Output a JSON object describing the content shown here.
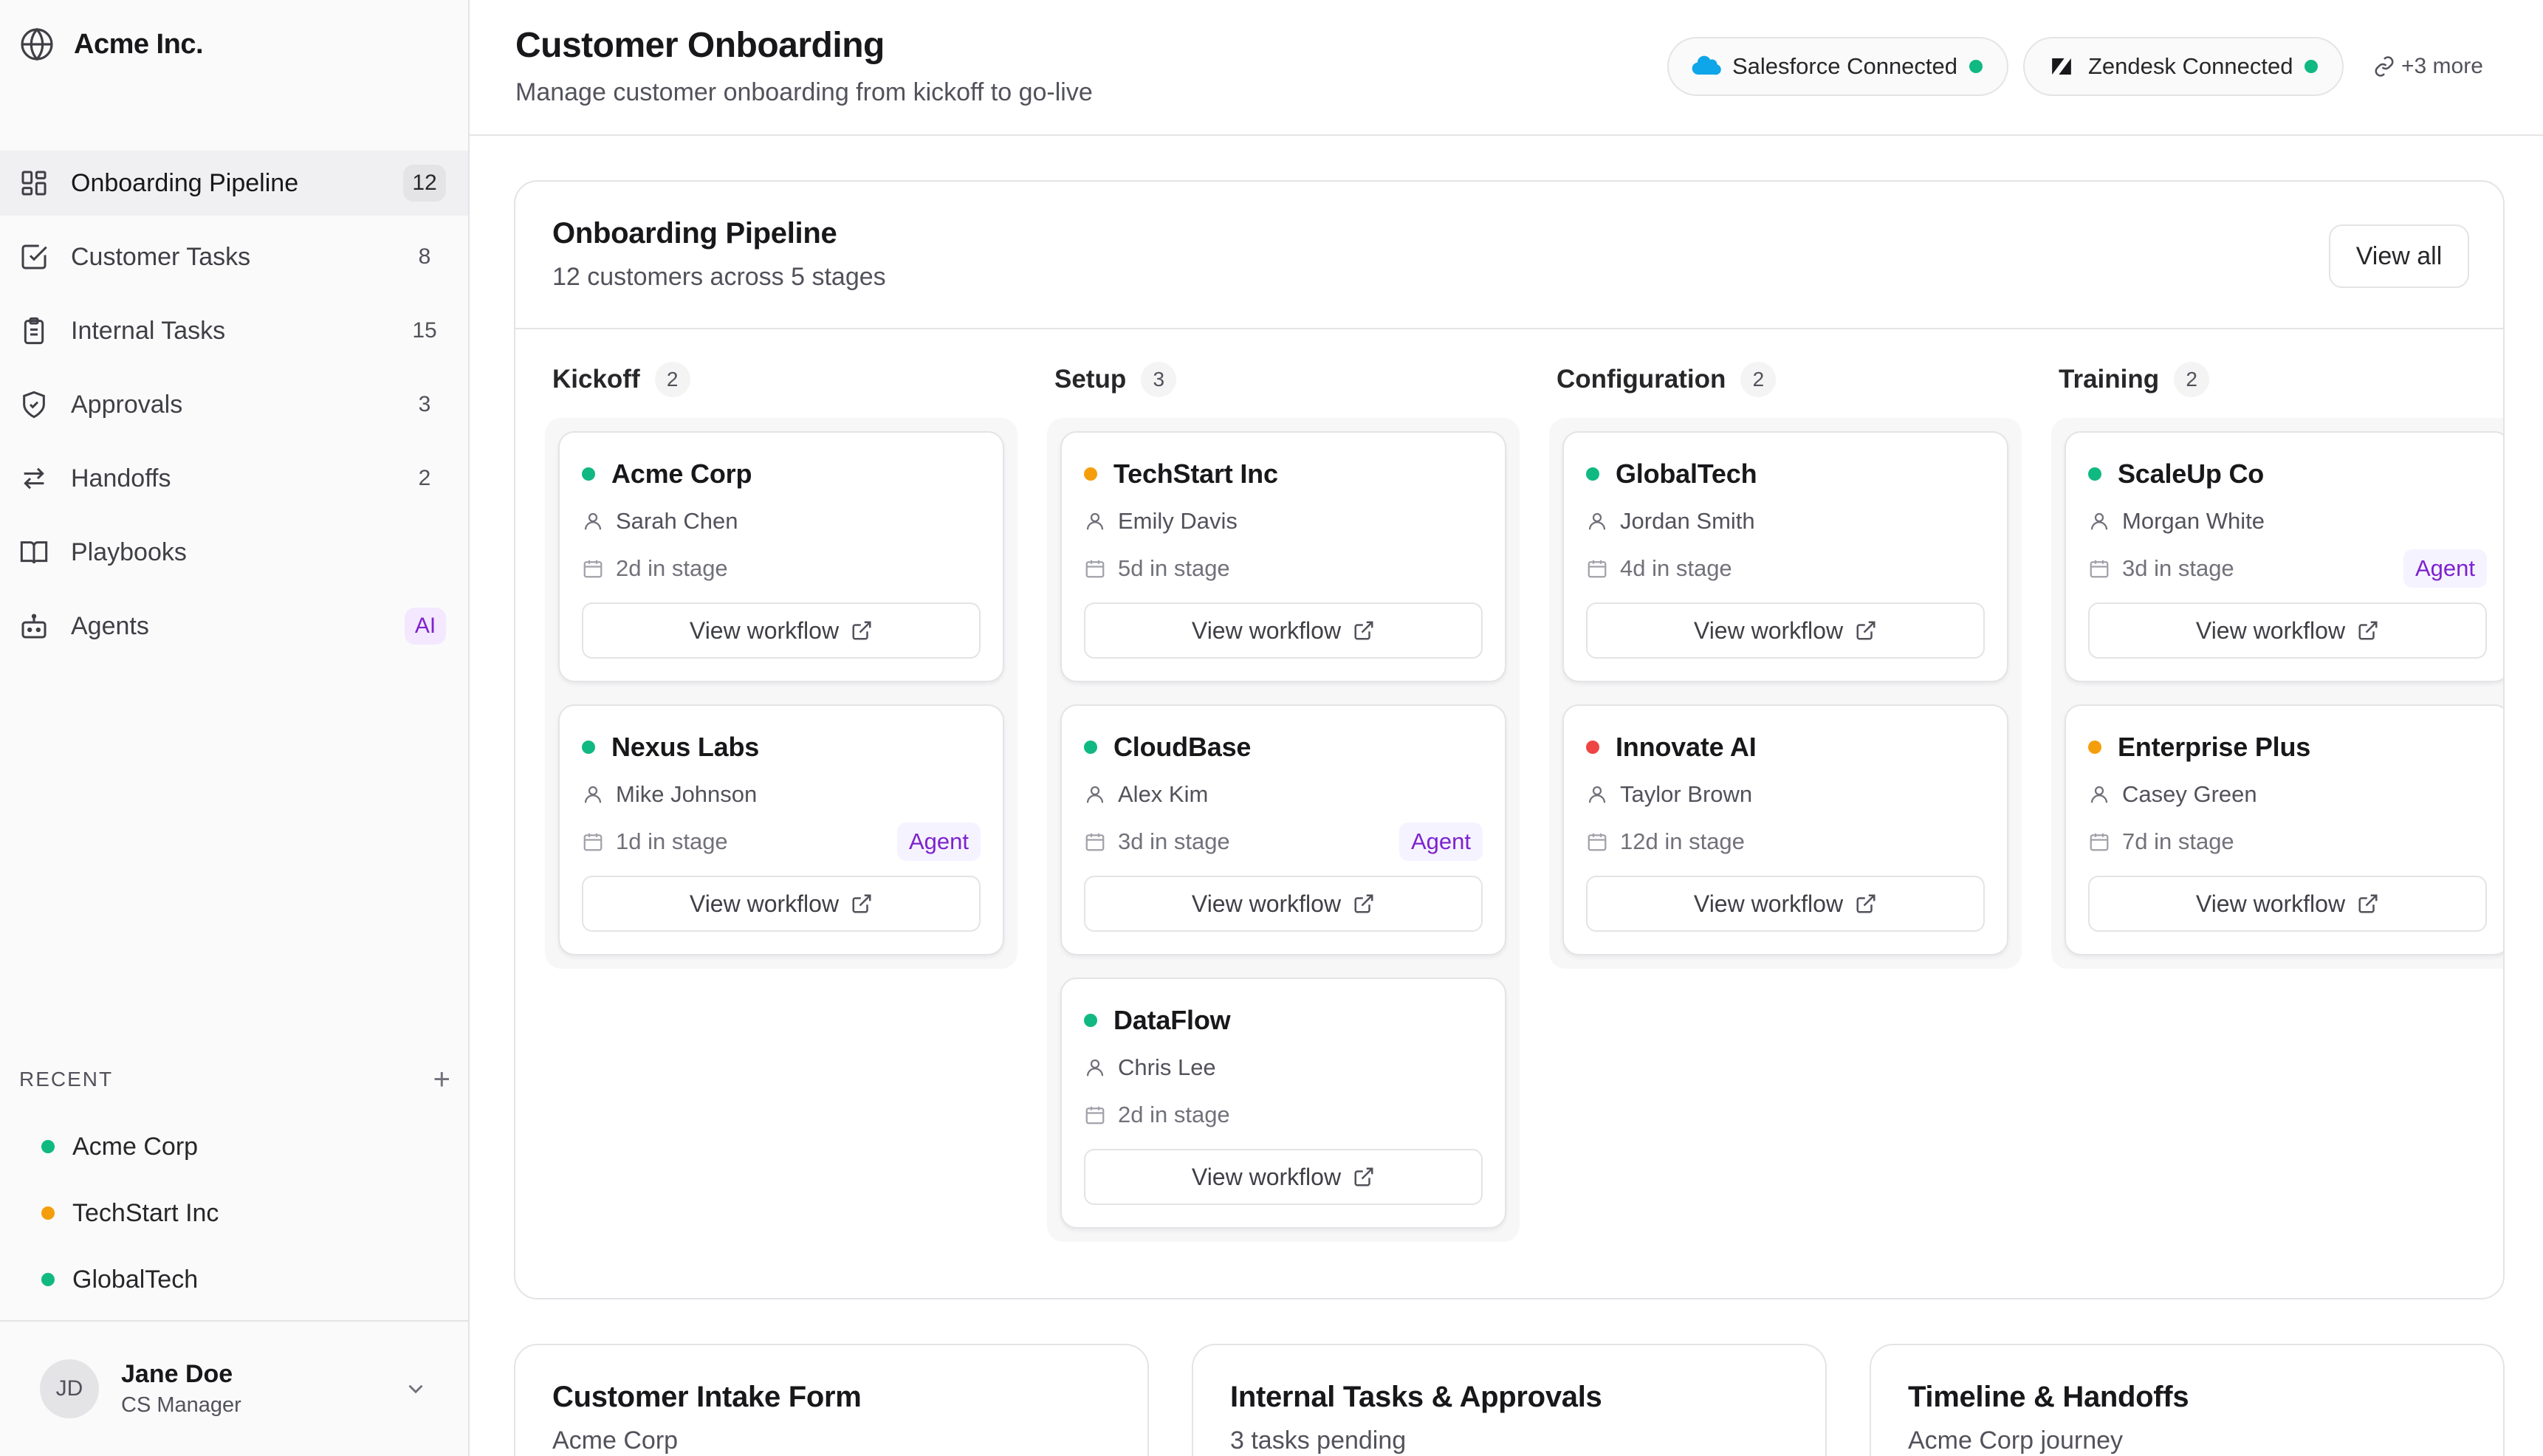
{
  "brand": {
    "name": "Acme Inc."
  },
  "sidebar": {
    "items": [
      {
        "label": "Onboarding Pipeline",
        "count": "12",
        "icon": "layout-grid-icon"
      },
      {
        "label": "Customer Tasks",
        "count": "8",
        "icon": "checkbox-icon"
      },
      {
        "label": "Internal Tasks",
        "count": "15",
        "icon": "clipboard-icon"
      },
      {
        "label": "Approvals",
        "count": "3",
        "icon": "shield-check-icon"
      },
      {
        "label": "Handoffs",
        "count": "2",
        "icon": "arrows-swap-icon"
      },
      {
        "label": "Playbooks",
        "count": "",
        "icon": "book-icon"
      },
      {
        "label": "Agents",
        "count": "AI",
        "icon": "bot-icon"
      }
    ],
    "recent_title": "RECENT",
    "recent": [
      {
        "label": "Acme Corp",
        "status": "green"
      },
      {
        "label": "TechStart Inc",
        "status": "orange"
      },
      {
        "label": "GlobalTech",
        "status": "green"
      }
    ],
    "user": {
      "initials": "JD",
      "name": "Jane Doe",
      "role": "CS Manager"
    }
  },
  "header": {
    "title": "Customer Onboarding",
    "subtitle": "Manage customer onboarding from kickoff to go-live",
    "integrations": [
      {
        "label": "Salesforce Connected",
        "icon": "salesforce-cloud-icon"
      },
      {
        "label": "Zendesk Connected",
        "icon": "zendesk-logo-icon"
      }
    ],
    "more": "+3 more"
  },
  "pipeline": {
    "title": "Onboarding Pipeline",
    "subtitle": "12 customers across 5 stages",
    "view_all": "View all",
    "workflow_label": "View workflow",
    "stages": [
      {
        "name": "Kickoff",
        "count": "2",
        "cards": [
          {
            "name": "Acme Corp",
            "owner": "Sarah Chen",
            "time": "2d in stage",
            "status": "green",
            "agent": ""
          },
          {
            "name": "Nexus Labs",
            "owner": "Mike Johnson",
            "time": "1d in stage",
            "status": "green",
            "agent": "Agent"
          }
        ]
      },
      {
        "name": "Setup",
        "count": "3",
        "cards": [
          {
            "name": "TechStart Inc",
            "owner": "Emily Davis",
            "time": "5d in stage",
            "status": "orange",
            "agent": ""
          },
          {
            "name": "CloudBase",
            "owner": "Alex Kim",
            "time": "3d in stage",
            "status": "green",
            "agent": "Agent"
          },
          {
            "name": "DataFlow",
            "owner": "Chris Lee",
            "time": "2d in stage",
            "status": "green",
            "agent": ""
          }
        ]
      },
      {
        "name": "Configuration",
        "count": "2",
        "cards": [
          {
            "name": "GlobalTech",
            "owner": "Jordan Smith",
            "time": "4d in stage",
            "status": "green",
            "agent": ""
          },
          {
            "name": "Innovate AI",
            "owner": "Taylor Brown",
            "time": "12d in stage",
            "status": "red",
            "agent": ""
          }
        ]
      },
      {
        "name": "Training",
        "count": "2",
        "cards": [
          {
            "name": "ScaleUp Co",
            "owner": "Morgan White",
            "time": "3d in stage",
            "status": "green",
            "agent": "Agent"
          },
          {
            "name": "Enterprise Plus",
            "owner": "Casey Green",
            "time": "7d in stage",
            "status": "orange",
            "agent": ""
          }
        ]
      }
    ]
  },
  "bottom_cards": [
    {
      "title": "Customer Intake Form",
      "subtitle": "Acme Corp"
    },
    {
      "title": "Internal Tasks & Approvals",
      "subtitle": "3 tasks pending"
    },
    {
      "title": "Timeline & Handoffs",
      "subtitle": "Acme Corp journey"
    }
  ],
  "colors": {
    "green": "#10b981",
    "orange": "#f59e0b",
    "red": "#ef4444",
    "accent": "#7e22ce"
  }
}
